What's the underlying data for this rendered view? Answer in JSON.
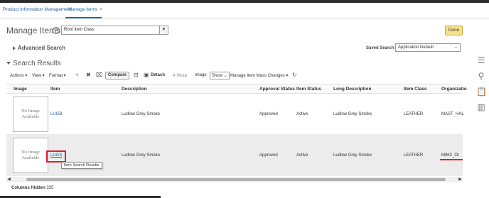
{
  "tabs": [
    {
      "label": "Product Information Management"
    },
    {
      "label": "Manage Items",
      "close": "×"
    }
  ],
  "page": {
    "title": "Manage Items",
    "help": "?",
    "item_class_value": "Root Item Class",
    "done_label": "Done"
  },
  "advanced_search": {
    "label": "Advanced Search"
  },
  "saved_search": {
    "label": "Saved Search",
    "value": "Application Default"
  },
  "search_results": {
    "title": "Search Results"
  },
  "toolbar": {
    "actions": "Actions ▾",
    "view": "View ▾",
    "format": "Format ▾",
    "compare": "Compare",
    "detach": "Detach",
    "wrap": "Wrap",
    "image_label": "Image",
    "image_select": "Show",
    "mass_changes": "Manage Item Mass Changes ▾"
  },
  "columns": [
    "Image",
    "Item",
    "Description",
    "Approval Status",
    "Item Status",
    "Long Description",
    "Item Class",
    "Organizatio"
  ],
  "no_image_text": "No Image Available",
  "rows": [
    {
      "item": "LUGB",
      "description": "Ludlow Grey Smoke",
      "approval": "Approved",
      "status": "Active",
      "long_description": "Ludlow Grey Smoke",
      "item_class": "LEATHER",
      "organization": "MAST_HAL"
    },
    {
      "item": "LUGS",
      "description": "Ludlow Grey Smoke",
      "approval": "Approved",
      "status": "Active",
      "long_description": "Ludlow Grey Smoke",
      "item_class": "LEATHER",
      "organization": "MIM2_OI"
    }
  ],
  "tooltip": "Item Search Results",
  "columns_hidden": {
    "label": "Columns Hidden",
    "value": "335"
  },
  "colors": {
    "link": "#1e5fa3",
    "done_button": "#f6e28c",
    "highlight": "#e0202a"
  },
  "side_icons": [
    "list-icon",
    "search-icon",
    "clipboard-icon",
    "chart-icon"
  ]
}
